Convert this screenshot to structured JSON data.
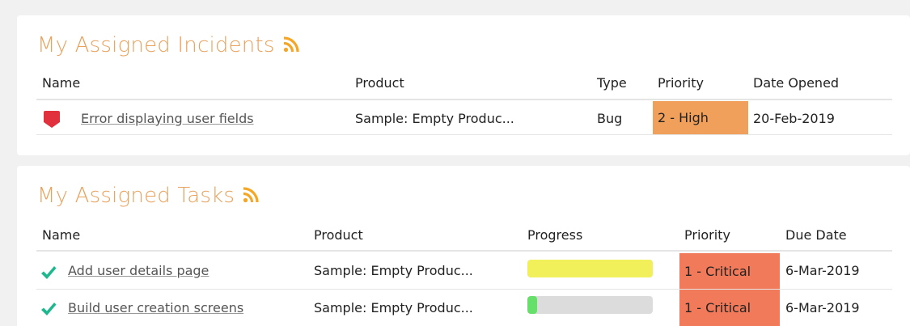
{
  "colors": {
    "title": "#e8a25c",
    "rss": "#f5a623",
    "priority_high": "#f0a05a",
    "priority_critical": "#f07a5a",
    "bug_icon": "#e0313c",
    "check_icon": "#1fb88e",
    "progress_yellow": "#f2f05a",
    "progress_green": "#66e06a",
    "progress_track": "#dcdcdc"
  },
  "incidents": {
    "title": "My Assigned Incidents",
    "columns": {
      "name": "Name",
      "product": "Product",
      "type": "Type",
      "priority": "Priority",
      "date_opened": "Date Opened"
    },
    "rows": [
      {
        "icon": "bug-icon",
        "name": "Error displaying user fields",
        "product": "Sample: Empty Produc...",
        "type": "Bug",
        "priority": "2 - High",
        "date_opened": "20-Feb-2019"
      }
    ]
  },
  "tasks": {
    "title": "My Assigned Tasks",
    "columns": {
      "name": "Name",
      "product": "Product",
      "progress": "Progress",
      "priority": "Priority",
      "due_date": "Due Date"
    },
    "rows": [
      {
        "icon": "check-icon",
        "name": "Add user details page",
        "product": "Sample: Empty Produc...",
        "progress": 1.0,
        "progress_color": "#f2f05a",
        "priority": "1 - Critical",
        "due_date": "6-Mar-2019"
      },
      {
        "icon": "check-icon",
        "name": "Build user creation screens",
        "product": "Sample: Empty Produc...",
        "progress": 0.08,
        "progress_color": "#66e06a",
        "priority": "1 - Critical",
        "due_date": "6-Mar-2019"
      }
    ]
  }
}
